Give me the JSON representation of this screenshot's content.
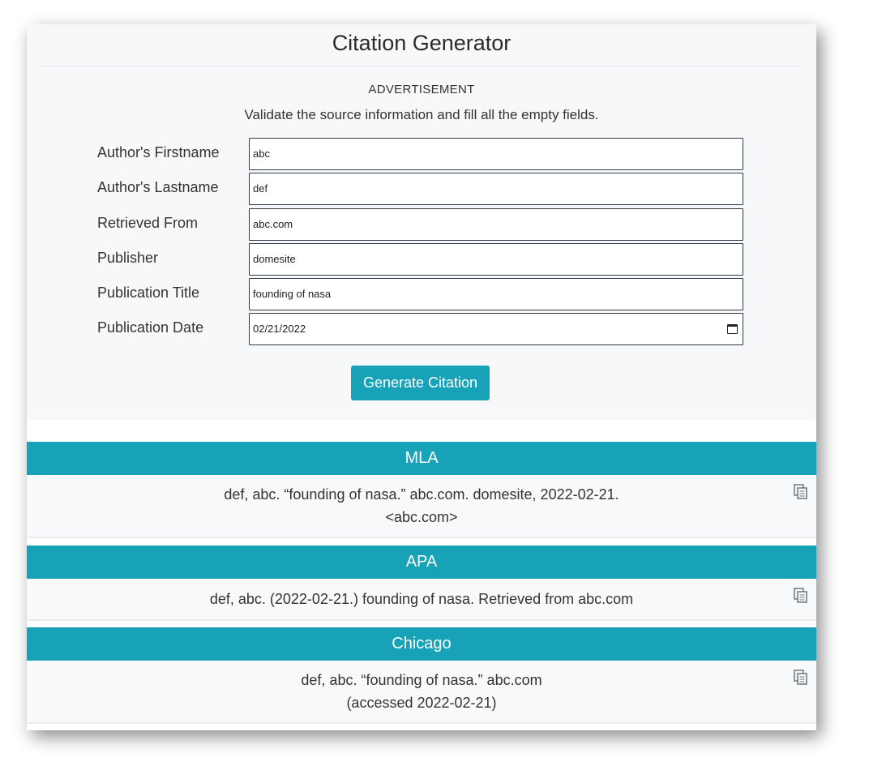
{
  "page": {
    "title": "Citation Generator",
    "advertisement_label": "ADVERTISEMENT",
    "instructions": "Validate the source information and fill all the empty fields."
  },
  "form": {
    "fields": [
      {
        "label": "Author's Firstname",
        "value": "abc"
      },
      {
        "label": "Author's Lastname",
        "value": "def"
      },
      {
        "label": "Retrieved From",
        "value": "abc.com"
      },
      {
        "label": "Publisher",
        "value": "domesite"
      },
      {
        "label": "Publication Title",
        "value": "founding of nasa"
      },
      {
        "label": "Publication Date",
        "value": "02/21/2022",
        "icon": "calendar-icon"
      }
    ],
    "generate_label": "Generate Citation"
  },
  "results": {
    "mla": {
      "heading": "MLA",
      "line1": "def, abc. “founding of nasa.” abc.com. domesite, 2022-02-21.",
      "line2": "<abc.com>",
      "icon": "copy-icon"
    },
    "apa": {
      "heading": "APA",
      "line1": "def, abc. (2022-02-21.) founding of nasa. Retrieved from abc.com",
      "icon": "copy-icon"
    },
    "chicago": {
      "heading": "Chicago",
      "line1": "def, abc. “founding of nasa.” abc.com",
      "line2": "(accessed 2022-02-21)",
      "icon": "copy-icon"
    }
  },
  "colors": {
    "accent": "#17a2b8",
    "form_background": "#f6f8fa",
    "result_background": "#f8f9fa"
  }
}
